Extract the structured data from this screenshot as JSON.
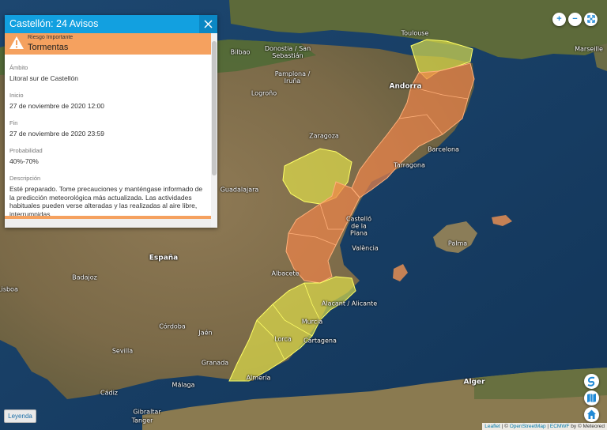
{
  "map": {
    "places": [
      {
        "id": "toulouse",
        "label": "Toulouse"
      },
      {
        "id": "bilbao",
        "label": "Bilbao"
      },
      {
        "id": "donostia",
        "label": "Donostia / San Sebastián"
      },
      {
        "id": "pamplona",
        "label": "Pamplona / Iruña"
      },
      {
        "id": "logrono",
        "label": "Logroño"
      },
      {
        "id": "andorra",
        "label": "Andorra"
      },
      {
        "id": "marseille",
        "label": "Marseille"
      },
      {
        "id": "zaragoza",
        "label": "Zaragoza"
      },
      {
        "id": "barcelona",
        "label": "Barcelona"
      },
      {
        "id": "tarragona",
        "label": "Tarragona"
      },
      {
        "id": "guadalajara",
        "label": "Guadalajara"
      },
      {
        "id": "castellon",
        "label": "Castelló de la Plana"
      },
      {
        "id": "valencia",
        "label": "València"
      },
      {
        "id": "palma",
        "label": "Palma"
      },
      {
        "id": "espana",
        "label": "España"
      },
      {
        "id": "badajoz",
        "label": "Badajoz"
      },
      {
        "id": "albacete",
        "label": "Albacete"
      },
      {
        "id": "alacant",
        "label": "Alacant / Alicante"
      },
      {
        "id": "murcia",
        "label": "Murcia"
      },
      {
        "id": "cordoba",
        "label": "Córdoba"
      },
      {
        "id": "jaen",
        "label": "Jaén"
      },
      {
        "id": "sevilla",
        "label": "Sevilla"
      },
      {
        "id": "cartagena",
        "label": "Cartagena"
      },
      {
        "id": "lorca",
        "label": "Lorca"
      },
      {
        "id": "granada",
        "label": "Granada"
      },
      {
        "id": "almeria",
        "label": "Almería"
      },
      {
        "id": "malaga",
        "label": "Málaga"
      },
      {
        "id": "cadiz",
        "label": "Cádiz"
      },
      {
        "id": "gibraltar",
        "label": "Gibraltar"
      },
      {
        "id": "tanger",
        "label": "Tanger"
      },
      {
        "id": "alger",
        "label": "Alger"
      },
      {
        "id": "lisboa",
        "label": "Lisboa"
      }
    ],
    "colors": {
      "warning_orange": "#f0854a",
      "warning_yellow": "#e6e64c"
    }
  },
  "panel": {
    "title": "Castellón: 24 Avisos",
    "risk_level": "Riesgo Importante",
    "event": "Tormentas",
    "fields": [
      {
        "label": "Ámbito",
        "value": "Litoral sur de Castellón"
      },
      {
        "label": "Inicio",
        "value": "27 de noviembre de 2020 12:00"
      },
      {
        "label": "Fin",
        "value": "27 de noviembre de 2020 23:59"
      },
      {
        "label": "Probabilidad",
        "value": "40%-70%"
      }
    ],
    "description_label": "Descripción",
    "description": "Esté preparado. Tome precauciones y manténgase informado de la predicción meteorológica más actualizada. Las actividades habituales pueden verse alteradas y las realizadas al aire libre, interrumpidas.",
    "colors": {
      "header": "#12a0e0",
      "risk": "#f5a15f"
    }
  },
  "controls": {
    "zoom_in": "+",
    "zoom_out": "−",
    "legend": "Leyenda"
  },
  "attribution": {
    "leaflet": "Leaflet",
    "osm": "OpenStreetMap",
    "ecmwf": "ECMWF",
    "meteored": "© Meteored"
  }
}
